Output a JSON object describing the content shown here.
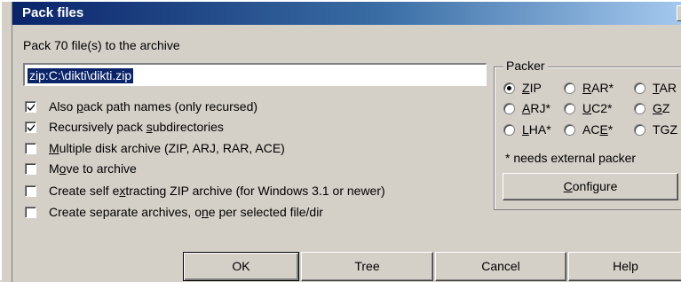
{
  "window": {
    "title": "Pack files",
    "close_label": "x"
  },
  "header": {
    "label": "Pack 70 file(s) to the archive"
  },
  "path_field": {
    "value": "zip:C:\\dikti\\dikti.zip"
  },
  "options": [
    {
      "pre": "Also ",
      "ul": "p",
      "post": "ack path names (only recursed)",
      "checked": true
    },
    {
      "pre": "Recursively pack ",
      "ul": "s",
      "post": "ubdirectories",
      "checked": true
    },
    {
      "pre": "",
      "ul": "M",
      "post": "ultiple disk archive (ZIP, ARJ, RAR, ACE)",
      "checked": false
    },
    {
      "pre": "M",
      "ul": "o",
      "post": "ve to archive",
      "checked": false
    },
    {
      "pre": "Create self e",
      "ul": "x",
      "post": "tracting ZIP archive (for Windows 3.1 or newer)",
      "checked": false
    },
    {
      "pre": "Create separate archives, o",
      "ul": "n",
      "post": "e per selected file/dir",
      "checked": false
    }
  ],
  "packer": {
    "legend": "Packer",
    "radios": [
      {
        "ul": "Z",
        "post": "IP",
        "selected": true
      },
      {
        "ul": "R",
        "post": "AR*",
        "selected": false
      },
      {
        "ul": "T",
        "post": "AR",
        "selected": false
      },
      {
        "ul": "A",
        "post": "RJ*",
        "selected": false
      },
      {
        "ul": "U",
        "post": "C2*",
        "selected": false
      },
      {
        "ul": "G",
        "post": "Z",
        "selected": false
      },
      {
        "ul": "L",
        "post": "HA*",
        "selected": false
      },
      {
        "pre": "AC",
        "ul": "E",
        "post": "*",
        "selected": false
      },
      {
        "ul": "",
        "post": "TGZ",
        "selected": false
      }
    ],
    "note": "* needs external packer",
    "configure": {
      "ul": "C",
      "post": "onfigure"
    }
  },
  "buttons": {
    "ok": "OK",
    "tree": "Tree",
    "cancel": "Cancel",
    "help": "Help"
  }
}
